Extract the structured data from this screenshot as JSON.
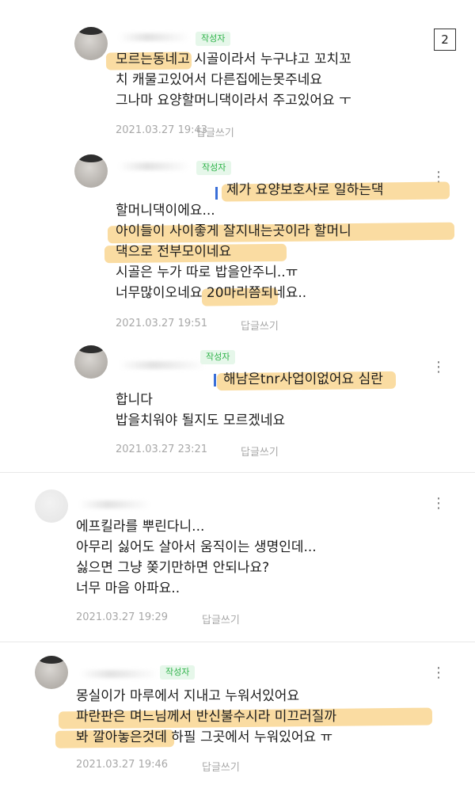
{
  "page_number": "2",
  "comments": [
    {
      "author_badge": "작성자",
      "lines": [
        {
          "pre": "",
          "hl": "모르는동네",
          "post": "고 시골이라서 누구냐고 꼬치꼬"
        },
        {
          "pre": "치 캐물고있어서 다른집에는못주네요",
          "hl": "",
          "post": ""
        },
        {
          "pre": "그나마 요양할머니댁이라서 주고있어요 ㅜ",
          "hl": "",
          "post": ""
        }
      ],
      "date": "2021.03.27 19:43",
      "reply_label": "답글쓰기"
    },
    {
      "author_badge": "작성자",
      "lines": [
        {
          "pre": "",
          "hl": "제가 요양보호사로 일하는댁",
          "post": ""
        },
        {
          "pre": "할머니댁이에요...",
          "hl": "",
          "post": ""
        },
        {
          "pre": "",
          "hl": "아이들이 사이좋게 잘지내는곳이라 할머니",
          "post": ""
        },
        {
          "pre": "",
          "hl": "댁으로 전부모이네요",
          "post": ""
        },
        {
          "pre": "시골은 누가 따로 밥을안주니..ㅠ",
          "hl": "",
          "post": ""
        },
        {
          "pre": "너무많이오네요 ",
          "hl": "20마리",
          "post": "쯤되네요.."
        }
      ],
      "date": "2021.03.27 19:51",
      "reply_label": "답글쓰기",
      "more_icon": "⋮"
    },
    {
      "author_badge": "작성자",
      "lines": [
        {
          "pre": "",
          "hl": "해남은tnr사업이없어요",
          "post": " 심란"
        },
        {
          "pre": "합니다",
          "hl": "",
          "post": ""
        },
        {
          "pre": "밥을치워야 될지도 모르겠네요",
          "hl": "",
          "post": ""
        }
      ],
      "date": "2021.03.27 23:21",
      "reply_label": "답글쓰기",
      "more_icon": "⋮"
    },
    {
      "author_badge": "",
      "lines": [
        {
          "pre": "에프킬라를 뿌린다니...",
          "hl": "",
          "post": ""
        },
        {
          "pre": "아무리 싫어도 살아서 움직이는 생명인데...",
          "hl": "",
          "post": ""
        },
        {
          "pre": "싫으면 그냥 쫒기만하면 안되나요?",
          "hl": "",
          "post": ""
        },
        {
          "pre": "너무 마음 아파요..",
          "hl": "",
          "post": ""
        }
      ],
      "date": "2021.03.27 19:29",
      "reply_label": "답글쓰기",
      "more_icon": "⋮"
    },
    {
      "author_badge": "작성자",
      "lines": [
        {
          "pre": "몽실이가 마루에서 지내고 누워서있어요",
          "hl": "",
          "post": ""
        },
        {
          "pre": "",
          "hl": "파란판은 며느님께서 반신불수시라 미끄러질까",
          "post": ""
        },
        {
          "pre": "",
          "hl": "봐 깔아놓은",
          "post": "것데 하필 그곳에서 누워있어요 ㅠ"
        }
      ],
      "date": "2021.03.27 19:46",
      "reply_label": "답글쓰기",
      "more_icon": "⋮"
    }
  ]
}
